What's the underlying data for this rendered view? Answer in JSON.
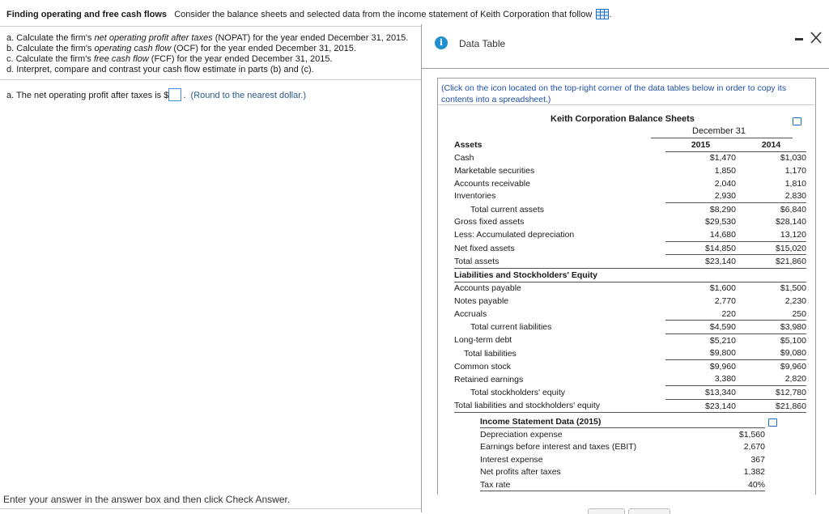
{
  "header": {
    "title": "Finding operating and free cash flows",
    "text": "Consider the balance sheets and selected data from the income statement of Keith Corporation that follow",
    "icon": "table-grid-icon"
  },
  "questions": {
    "a_pre": "a. Calculate the firm's ",
    "a_em": "net operating profit after taxes",
    "a_post": " (NOPAT) for the year ended December 31, 2015.",
    "b_pre": "b. Calculate the firm's ",
    "b_em": "operating cash flow",
    "b_post": " (OCF) for the year ended December 31, 2015.",
    "c_pre": "c. Calculate the firm's ",
    "c_em": "free cash flow",
    "c_post": " (FCF) for the year ended December 31, 2015.",
    "d": "d. Interpret, compare and contrast your cash flow estimate in parts (b) and (c)."
  },
  "answer": {
    "prefix": "a. The net operating profit after taxes is $",
    "value": "",
    "suffix": ".",
    "note": "(Round to the nearest dollar.)"
  },
  "footer": "Enter your answer in the answer box and then click Check Answer.",
  "popup": {
    "title": "Data Table",
    "click_note": "(Click on the icon located on the top-right corner of the data tables below in order to copy its contents into a spreadsheet.)",
    "balance_title": "Keith Corporation Balance Sheets",
    "dec_header": "December 31",
    "col_2015": "2015",
    "col_2014": "2014",
    "assets_header": "Assets",
    "rows_assets": [
      {
        "label": "Cash",
        "v2015": "$1,470",
        "v2014": "$1,030"
      },
      {
        "label": "Marketable securities",
        "v2015": "1,850",
        "v2014": "1,170"
      },
      {
        "label": "Accounts receivable",
        "v2015": "2,040",
        "v2014": "1,810"
      },
      {
        "label": "Inventories",
        "v2015": "2,930",
        "v2014": "2,830"
      },
      {
        "label": "Total current assets",
        "v2015": "$8,290",
        "v2014": "$6,840"
      },
      {
        "label": "Gross fixed assets",
        "v2015": "$29,530",
        "v2014": "$28,140"
      },
      {
        "label": "Less: Accumulated depreciation",
        "v2015": "14,680",
        "v2014": "13,120"
      },
      {
        "label": "Net fixed assets",
        "v2015": "$14,850",
        "v2014": "$15,020"
      },
      {
        "label": "Total assets",
        "v2015": "$23,140",
        "v2014": "$21,860"
      }
    ],
    "liab_header": "Liabilities and Stockholders' Equity",
    "rows_liab": [
      {
        "label": "Accounts payable",
        "v2015": "$1,600",
        "v2014": "$1,500"
      },
      {
        "label": "Notes payable",
        "v2015": "2,770",
        "v2014": "2,230"
      },
      {
        "label": "Accruals",
        "v2015": "220",
        "v2014": "250"
      },
      {
        "label": "Total current liabilities",
        "v2015": "$4,590",
        "v2014": "$3,980"
      },
      {
        "label": "Long-term debt",
        "v2015": "$5,210",
        "v2014": "$5,100"
      },
      {
        "label": "Total liabilities",
        "v2015": "$9,800",
        "v2014": "$9,080"
      },
      {
        "label": "Common stock",
        "v2015": "$9,960",
        "v2014": "$9,960"
      },
      {
        "label": "Retained earnings",
        "v2015": "3,380",
        "v2014": "2,820"
      },
      {
        "label": "Total stockholders' equity",
        "v2015": "$13,340",
        "v2014": "$12,780"
      },
      {
        "label": "Total liabilities and stockholders' equity",
        "v2015": "$23,140",
        "v2014": "$21,860"
      }
    ],
    "income_title": "Income Statement Data (2015)",
    "rows_income": [
      {
        "label": "Depreciation expense",
        "value": "$1,560"
      },
      {
        "label": "Earnings before interest and taxes (EBIT)",
        "value": "2,670"
      },
      {
        "label": "Interest expense",
        "value": "367"
      },
      {
        "label": "Net profits after taxes",
        "value": "1,382"
      },
      {
        "label": "Tax rate",
        "value": "40%"
      }
    ]
  },
  "colors": {
    "accent": "#1f8fd0",
    "link": "#1f4fa8",
    "input_border": "#3f8fd6"
  }
}
